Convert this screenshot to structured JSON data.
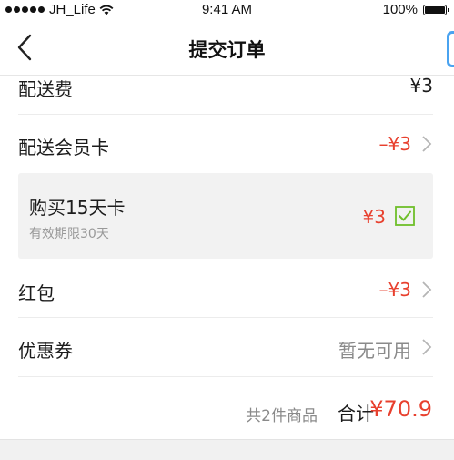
{
  "status_bar": {
    "carrier": "JH_Life",
    "time": "9:41 AM",
    "battery": "100%"
  },
  "nav": {
    "title": "提交订单"
  },
  "rows": {
    "shipping_fee": {
      "label": "配送费",
      "value": "¥3"
    },
    "member_card": {
      "label": "配送会员卡",
      "value": "–¥3"
    },
    "red_packet": {
      "label": "红包",
      "value": "–¥3"
    },
    "coupon": {
      "label": "优惠券",
      "value": "暂无可用"
    }
  },
  "card_option": {
    "title": "购买15天卡",
    "subtitle": "有效期限30天",
    "price": "¥3",
    "checked": true
  },
  "footer": {
    "item_count": "共2件商品",
    "total_label": "合计",
    "total_value": "¥70.9"
  },
  "colors": {
    "accent_red": "#e8402e",
    "check_green": "#6fbf2a",
    "side_tab_blue": "#4aa3f0"
  },
  "icons": [
    "wifi-icon",
    "battery-icon",
    "back-arrow-icon",
    "chevron-right-icon",
    "checkbox-checked-icon"
  ]
}
